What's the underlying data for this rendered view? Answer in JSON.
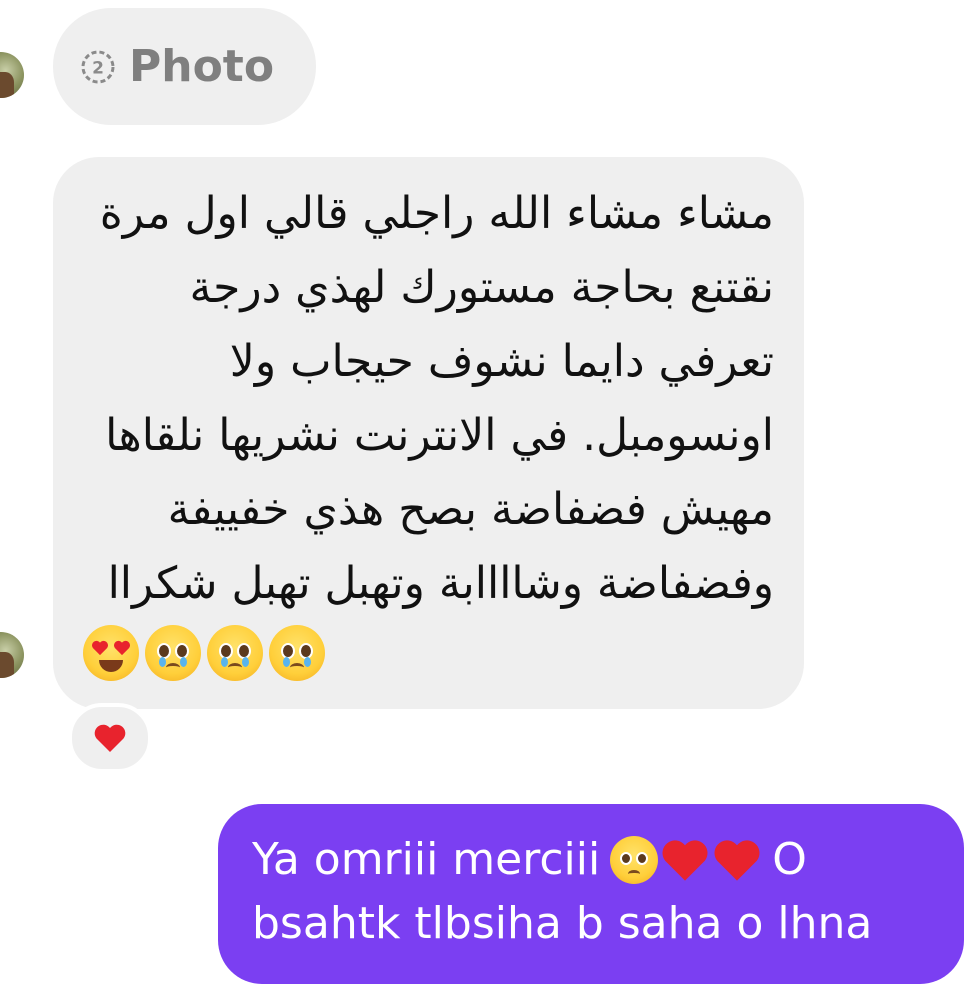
{
  "photo_message": {
    "icon": "view-once-icon",
    "label": "Photo",
    "view_count": "2"
  },
  "received_message": {
    "lines": [
      "مشاء مشاء الله راجلي قالي اول مرة",
      "نقتنع بحاجة مستورك لهذي درجة",
      "تعرفي دايما نشوف حيجاب ولا",
      "اونسومبل. في الانترنت نشريها نلقاها",
      "مهيش فضفاضة بصح هذي خفييفة",
      "وفضفاضة وشاااابة وتهبل تهبل شكراا"
    ],
    "emojis": [
      "crying-face-emoji",
      "crying-face-emoji",
      "crying-face-emoji",
      "heart-eyes-emoji"
    ]
  },
  "reaction": {
    "icon": "red-heart-icon"
  },
  "sent_message": {
    "line1_text_before": "Ya omriii merciii",
    "line1_emojis": [
      "pleading-face-emoji",
      "red-heart-emoji",
      "red-heart-emoji"
    ],
    "line1_text_after": "O",
    "line2_text": "bsahtk tlbsiha b saha o lhna"
  },
  "colors": {
    "received_bubble": "#efefef",
    "sent_bubble": "#7b3ff2",
    "heart": "#e8232d"
  }
}
